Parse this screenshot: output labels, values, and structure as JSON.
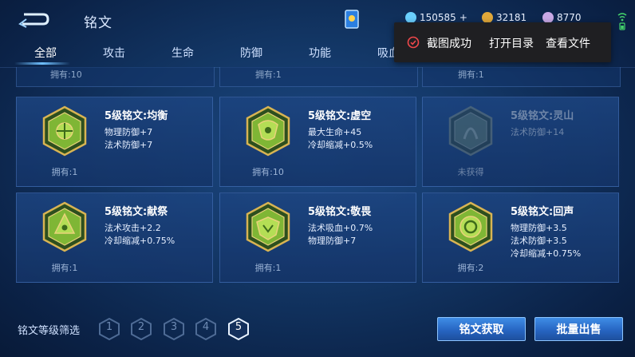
{
  "header": {
    "title": "铭文",
    "back_icon": "back-arrow-icon",
    "currency_diamond": "150585",
    "currency_diamond_plus": "+",
    "currency_gold": "32181",
    "currency_inscription": "8770"
  },
  "tabs": [
    {
      "label": "全部",
      "active": true
    },
    {
      "label": "攻击"
    },
    {
      "label": "生命"
    },
    {
      "label": "防御"
    },
    {
      "label": "功能"
    },
    {
      "label": "吸血"
    }
  ],
  "partial_row": [
    "拥有:10",
    "拥有:1",
    "拥有:1"
  ],
  "cards": [
    {
      "name": "5级铭文:均衡",
      "attrs": [
        "物理防御+7",
        "法术防御+7"
      ],
      "own": "拥有:1",
      "owned": true,
      "color": "#9ccf3e"
    },
    {
      "name": "5级铭文:虚空",
      "attrs": [
        "最大生命+45",
        "冷却缩减+0.5%"
      ],
      "own": "拥有:10",
      "owned": true,
      "color": "#9ccf3e"
    },
    {
      "name": "5级铭文:灵山",
      "attrs": [
        "法术防御+14"
      ],
      "own": "未获得",
      "owned": false,
      "color": "#5f7a6a"
    },
    {
      "name": "5级铭文:献祭",
      "attrs": [
        "法术攻击+2.2",
        "冷却缩减+0.75%"
      ],
      "own": "拥有:1",
      "owned": true,
      "color": "#9ccf3e"
    },
    {
      "name": "5级铭文:敬畏",
      "attrs": [
        "法术吸血+0.7%",
        "物理防御+7"
      ],
      "own": "拥有:1",
      "owned": true,
      "color": "#9ccf3e"
    },
    {
      "name": "5级铭文:回声",
      "attrs": [
        "物理防御+3.5",
        "法术防御+3.5",
        "冷却缩减+0.75%"
      ],
      "own": "拥有:2",
      "owned": true,
      "color": "#9ccf3e"
    }
  ],
  "filter": {
    "label": "铭文等级筛选",
    "levels": [
      "1",
      "2",
      "3",
      "4",
      "5"
    ],
    "active_level": "5"
  },
  "buttons": {
    "get": "铭文获取",
    "sell": "批量出售"
  },
  "toast": {
    "message": "截图成功",
    "open_dir": "打开目录",
    "view_file": "查看文件"
  }
}
